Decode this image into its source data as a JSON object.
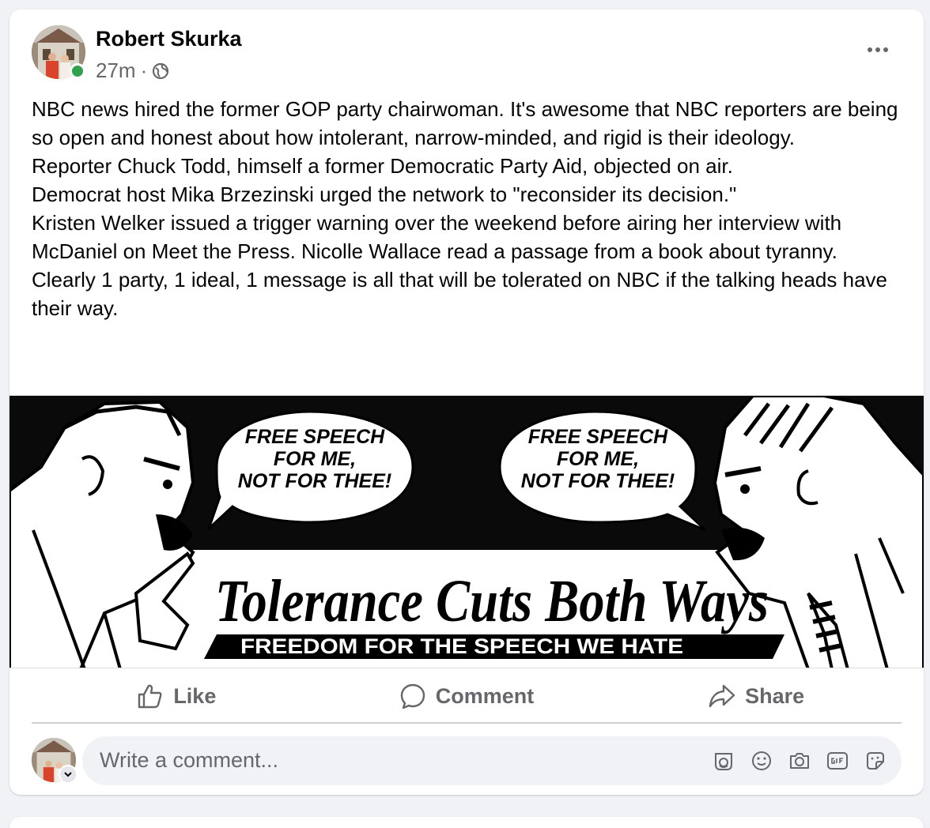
{
  "post": {
    "author": "Robert Skurka",
    "time": "27m",
    "separator": "·",
    "paragraphs": [
      "NBC news hired the former GOP party chairwoman. It's awesome that NBC reporters are being so open and honest about how intolerant, narrow-minded, and rigid is their ideology.",
      "Reporter Chuck Todd, himself a former Democratic Party Aid, objected on air.",
      "Democrat host Mika Brzezinski urged the network to \"reconsider its decision.\"",
      "Kristen Welker issued a trigger warning over the weekend before airing her interview with McDaniel on Meet the Press. Nicolle Wallace read a passage from a book about tyranny.",
      "Clearly 1 party, 1 ideal, 1 message is all that will be tolerated on NBC if the talking heads have their way."
    ],
    "image": {
      "bubble_left": [
        "FREE SPEECH",
        "FOR ME,",
        "NOT FOR THEE!"
      ],
      "bubble_right": [
        "FREE SPEECH",
        "FOR ME,",
        "NOT FOR THEE!"
      ],
      "headline": "Tolerance Cuts Both Ways",
      "subheadline": "FREEDOM FOR THE SPEECH WE HATE"
    }
  },
  "actions": {
    "like": "Like",
    "comment": "Comment",
    "share": "Share"
  },
  "comment_box": {
    "placeholder": "Write a comment...",
    "icons": [
      "avatar-sticker-icon",
      "emoji-icon",
      "camera-icon",
      "gif-icon",
      "sticker-icon"
    ]
  },
  "colors": {
    "online": "#31a24c",
    "secondary_text": "#65676b",
    "background": "#f0f2f5"
  }
}
